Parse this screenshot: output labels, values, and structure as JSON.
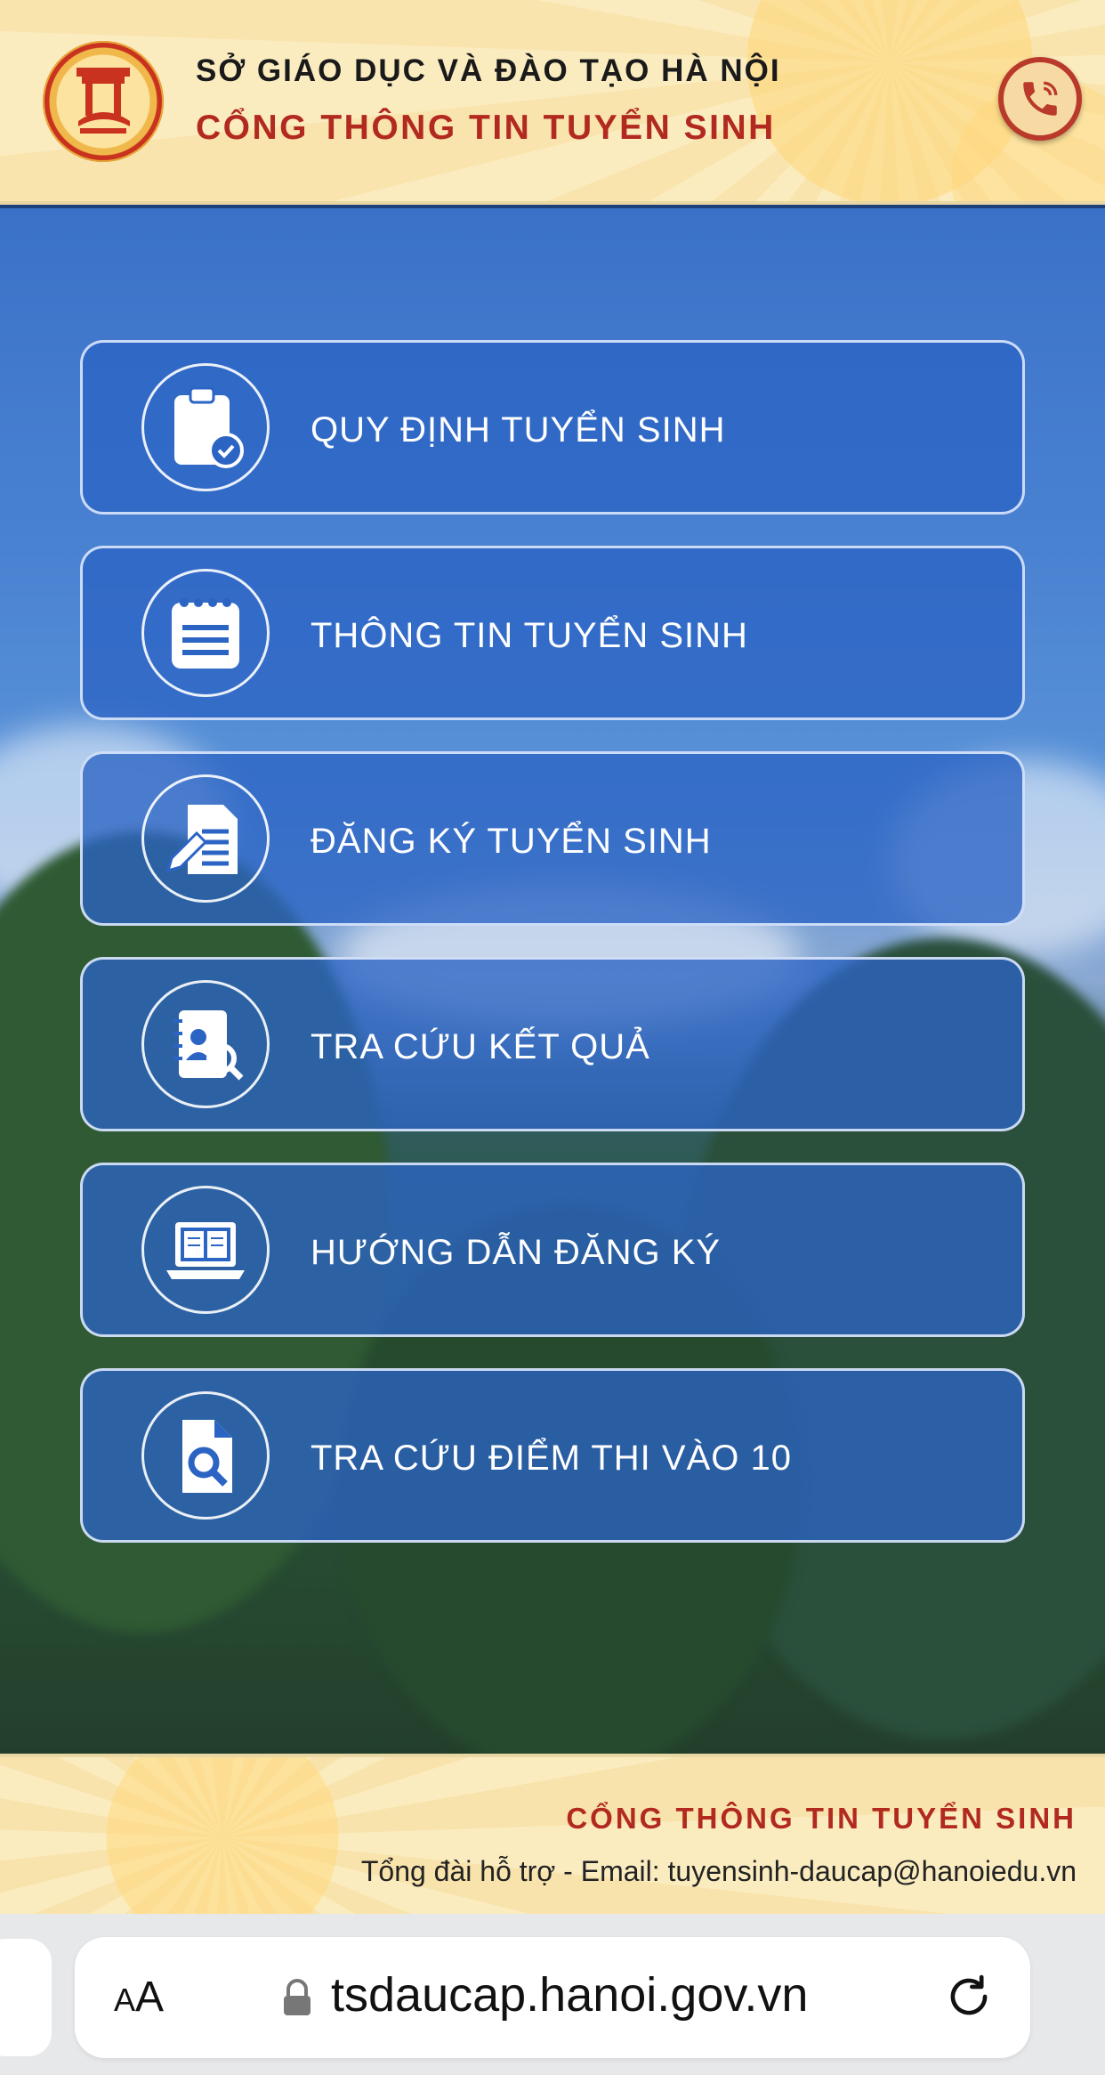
{
  "header": {
    "org_title": "SỞ GIÁO DỤC VÀ ĐÀO TẠO HÀ NỘI",
    "portal_title": "CỔNG THÔNG TIN TUYỂN SINH",
    "logo_icon": "hanoi-education-logo",
    "call_icon": "phone-icon"
  },
  "menu": {
    "items": [
      {
        "label": "QUY ĐỊNH TUYỂN SINH",
        "icon": "clipboard-check-icon"
      },
      {
        "label": "THÔNG TIN TUYỂN SINH",
        "icon": "notepad-icon"
      },
      {
        "label": "ĐĂNG KÝ TUYỂN SINH",
        "icon": "document-edit-icon"
      },
      {
        "label": "TRA CỨU KẾT QUẢ",
        "icon": "profile-search-icon"
      },
      {
        "label": "HƯỚNG DẪN ĐĂNG KÝ",
        "icon": "laptop-book-icon"
      },
      {
        "label": "TRA CỨU ĐIỂM THI VÀO 10",
        "icon": "file-search-icon"
      }
    ]
  },
  "footer": {
    "title": "CỔNG THÔNG TIN TUYỂN SINH",
    "contact": "Tổng đài hỗ trợ - Email: tuyensinh-daucap@hanoiedu.vn"
  },
  "browser": {
    "aa_label_big": "A",
    "aa_label_small": "A",
    "url": "tsdaucap.hanoi.gov.vn"
  },
  "colors": {
    "accent_red": "#b22a1f",
    "header_bg": "#fbecc0",
    "menu_bg": "#2c64c4"
  }
}
